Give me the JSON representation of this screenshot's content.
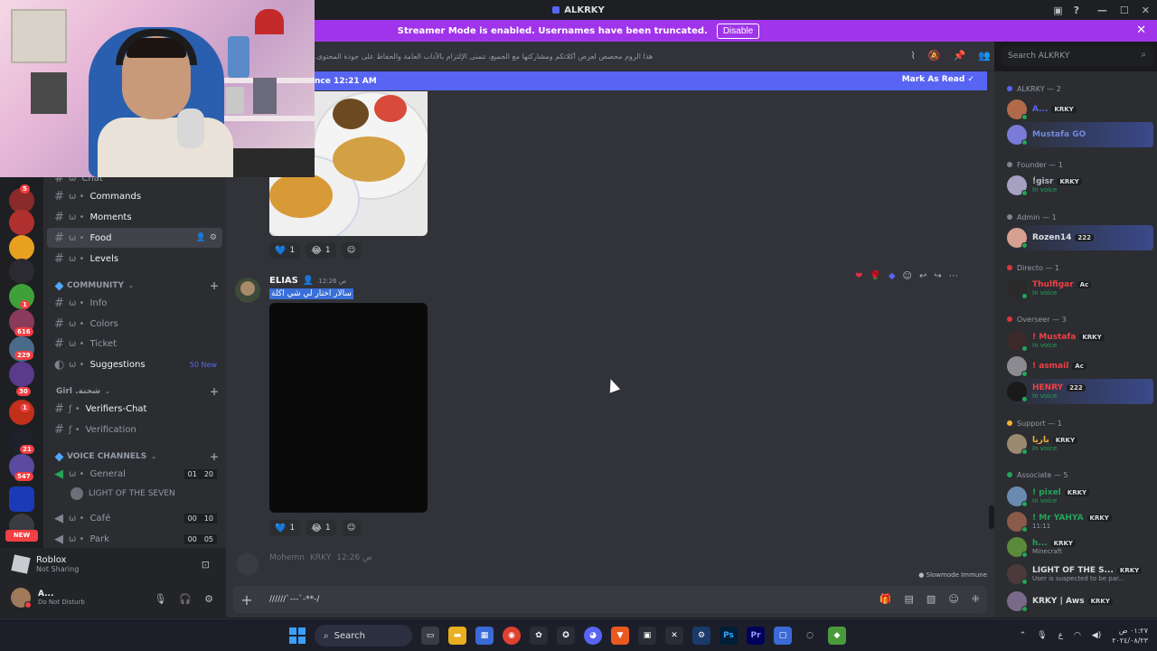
{
  "window": {
    "title": "ALKRKY"
  },
  "banner": {
    "text": "Streamer Mode is enabled. Usernames have been truncated.",
    "button": "Disable"
  },
  "header": {
    "topic": "هذا الروم مخصص لعرض أكلاتكم ومشاركتها مع الجميع، نتمنى الإلتزام بالآداب العامة والحفاظ على جودة المحتوى.",
    "search_placeholder": "Search ALKRKY"
  },
  "server_badges": [
    "5",
    "1",
    "616",
    "229",
    "30",
    "1",
    "21",
    "547"
  ],
  "new_badge": "NEW",
  "channels": {
    "items": [
      {
        "prefix": "ω",
        "label": "Chat"
      },
      {
        "prefix": "ω •",
        "label": "Commands"
      },
      {
        "prefix": "ω •",
        "label": "Moments"
      },
      {
        "prefix": "ω •",
        "label": "Food"
      },
      {
        "prefix": "ω •",
        "label": "Levels"
      }
    ],
    "community_category": "COMMUNITY",
    "community": [
      {
        "prefix": "ω •",
        "label": "Info"
      },
      {
        "prefix": "ω •",
        "label": "Colors"
      },
      {
        "prefix": "ω •",
        "label": "Ticket"
      },
      {
        "prefix": "ω •",
        "label": "Suggestions",
        "badge": "50 New"
      }
    ],
    "girl_category": "Girl .شخنة",
    "girl": [
      {
        "prefix": "ƒ •",
        "label": "Verifiers-Chat"
      },
      {
        "prefix": "ƒ •",
        "label": "Verification"
      }
    ],
    "voice_category": "VOICE CHANNELS",
    "voice": [
      {
        "prefix": "ω •",
        "label": "General",
        "count_a": "01",
        "count_b": "20"
      },
      {
        "prefix": "ω •",
        "label": "Café",
        "count_a": "00",
        "count_b": "10"
      },
      {
        "prefix": "ω •",
        "label": "Park",
        "count_a": "00",
        "count_b": "05"
      }
    ],
    "voice_user": "LIGHT OF THE SEVEN"
  },
  "chat": {
    "new_since": "nce 12:21 AM",
    "mark_read": "Mark As Read",
    "reactions_1": [
      {
        "emoji": "💙",
        "count": "1"
      },
      {
        "emoji": "😂",
        "count": "1"
      }
    ],
    "author": "ELIAS",
    "timestamp": "12:26 ص",
    "message": "سالار اختار لي شي اكلة",
    "reactions_2": [
      {
        "emoji": "💙",
        "count": "1"
      },
      {
        "emoji": "😂",
        "count": "1"
      }
    ],
    "next_author": "Mohemn",
    "next_tag": "KRKY",
    "next_time": "12:26 ص",
    "slowmode": "Slowmode Immune",
    "composer_text": "//////`---`-**-/"
  },
  "members": {
    "roles": [
      {
        "name": "ALKRKY — 2",
        "color": "#80848e"
      },
      {
        "name": "Founder — 1",
        "color": "#80848e"
      },
      {
        "name": "Admin — 1",
        "color": "#80848e"
      },
      {
        "name": "Directo — 1",
        "color": "#da373c"
      },
      {
        "name": "Overseer — 3",
        "color": "#da373c"
      },
      {
        "name": "Support — 1",
        "color": "#f0b232"
      },
      {
        "name": "Associate — 5",
        "color": "#23a55a"
      }
    ],
    "list": [
      {
        "name": "A...",
        "tag": "KRKY",
        "sub": "",
        "color": "#5865f2"
      },
      {
        "name": "Mustafa GO",
        "tag": "",
        "sub": "",
        "color": "#7289da"
      },
      {
        "name": "ٰٰ!gisr",
        "tag": "KRKY",
        "sub": "In voice",
        "color": "#b5bac1"
      },
      {
        "name": "Rozen14",
        "tag": "222",
        "sub": "",
        "color": "#dbdee1"
      },
      {
        "name": "Thulfigar",
        "tag": "Ac",
        "sub": "In voice",
        "color": "#f23f43"
      },
      {
        "name": "! Mustafa",
        "tag": "KRKY",
        "sub": "In voice",
        "color": "#f23f43"
      },
      {
        "name": "! asmail",
        "tag": "Ac",
        "sub": "",
        "color": "#f23f43"
      },
      {
        "name": "HENRY",
        "tag": "222",
        "sub": "In voice",
        "color": "#f23f43"
      },
      {
        "name": "باريا",
        "tag": "KRKY",
        "sub": "In voice",
        "color": "#f0b232"
      },
      {
        "name": "! pixel",
        "tag": "KRKY",
        "sub": "In voice",
        "color": "#23a55a"
      },
      {
        "name": "! Mr YAHYA",
        "tag": "KRKY",
        "sub": "11:11",
        "color": "#23a55a"
      },
      {
        "name": "h...",
        "tag": "KRKY",
        "sub": "Minecraft",
        "color": "#23a55a"
      },
      {
        "name": "LIGHT OF THE S...",
        "tag": "KRKY",
        "sub": "User is suspected to be par...",
        "color": "#dbdee1"
      },
      {
        "name": "KRKY | Aws",
        "tag": "KRKY",
        "sub": "",
        "color": "#dbdee1"
      }
    ]
  },
  "userpanel": {
    "activity": "Roblox",
    "activity_sub": "Not Sharing",
    "username": "A...",
    "status": "Do Not Disturb"
  },
  "taskbar": {
    "search": "Search",
    "time": "٠١:٢٧ ص",
    "date": "٢٠٢٤/٠٨/٢٣",
    "lang": "ع"
  }
}
